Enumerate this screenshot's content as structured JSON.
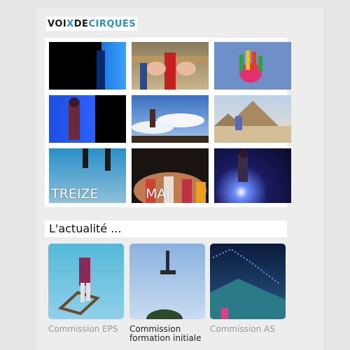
{
  "logo": {
    "part1": "VOI",
    "part2": "X",
    "part3": " DE ",
    "part4": "CIRQUES"
  },
  "grid": {
    "tiles": [
      {
        "caption": ""
      },
      {
        "caption": ""
      },
      {
        "caption": ""
      },
      {
        "caption": ""
      },
      {
        "caption": ""
      },
      {
        "caption": ""
      },
      {
        "caption": "TREIZE"
      },
      {
        "caption": "MAI"
      },
      {
        "caption": ""
      }
    ]
  },
  "news": {
    "heading": "L'actualité ..."
  },
  "cards": [
    {
      "label": "Commission EPS"
    },
    {
      "label": "Commission formation initiale"
    },
    {
      "label": "Commission AS"
    }
  ],
  "colors": {
    "accent": "#2a92c8",
    "muted_label": "#999999"
  }
}
